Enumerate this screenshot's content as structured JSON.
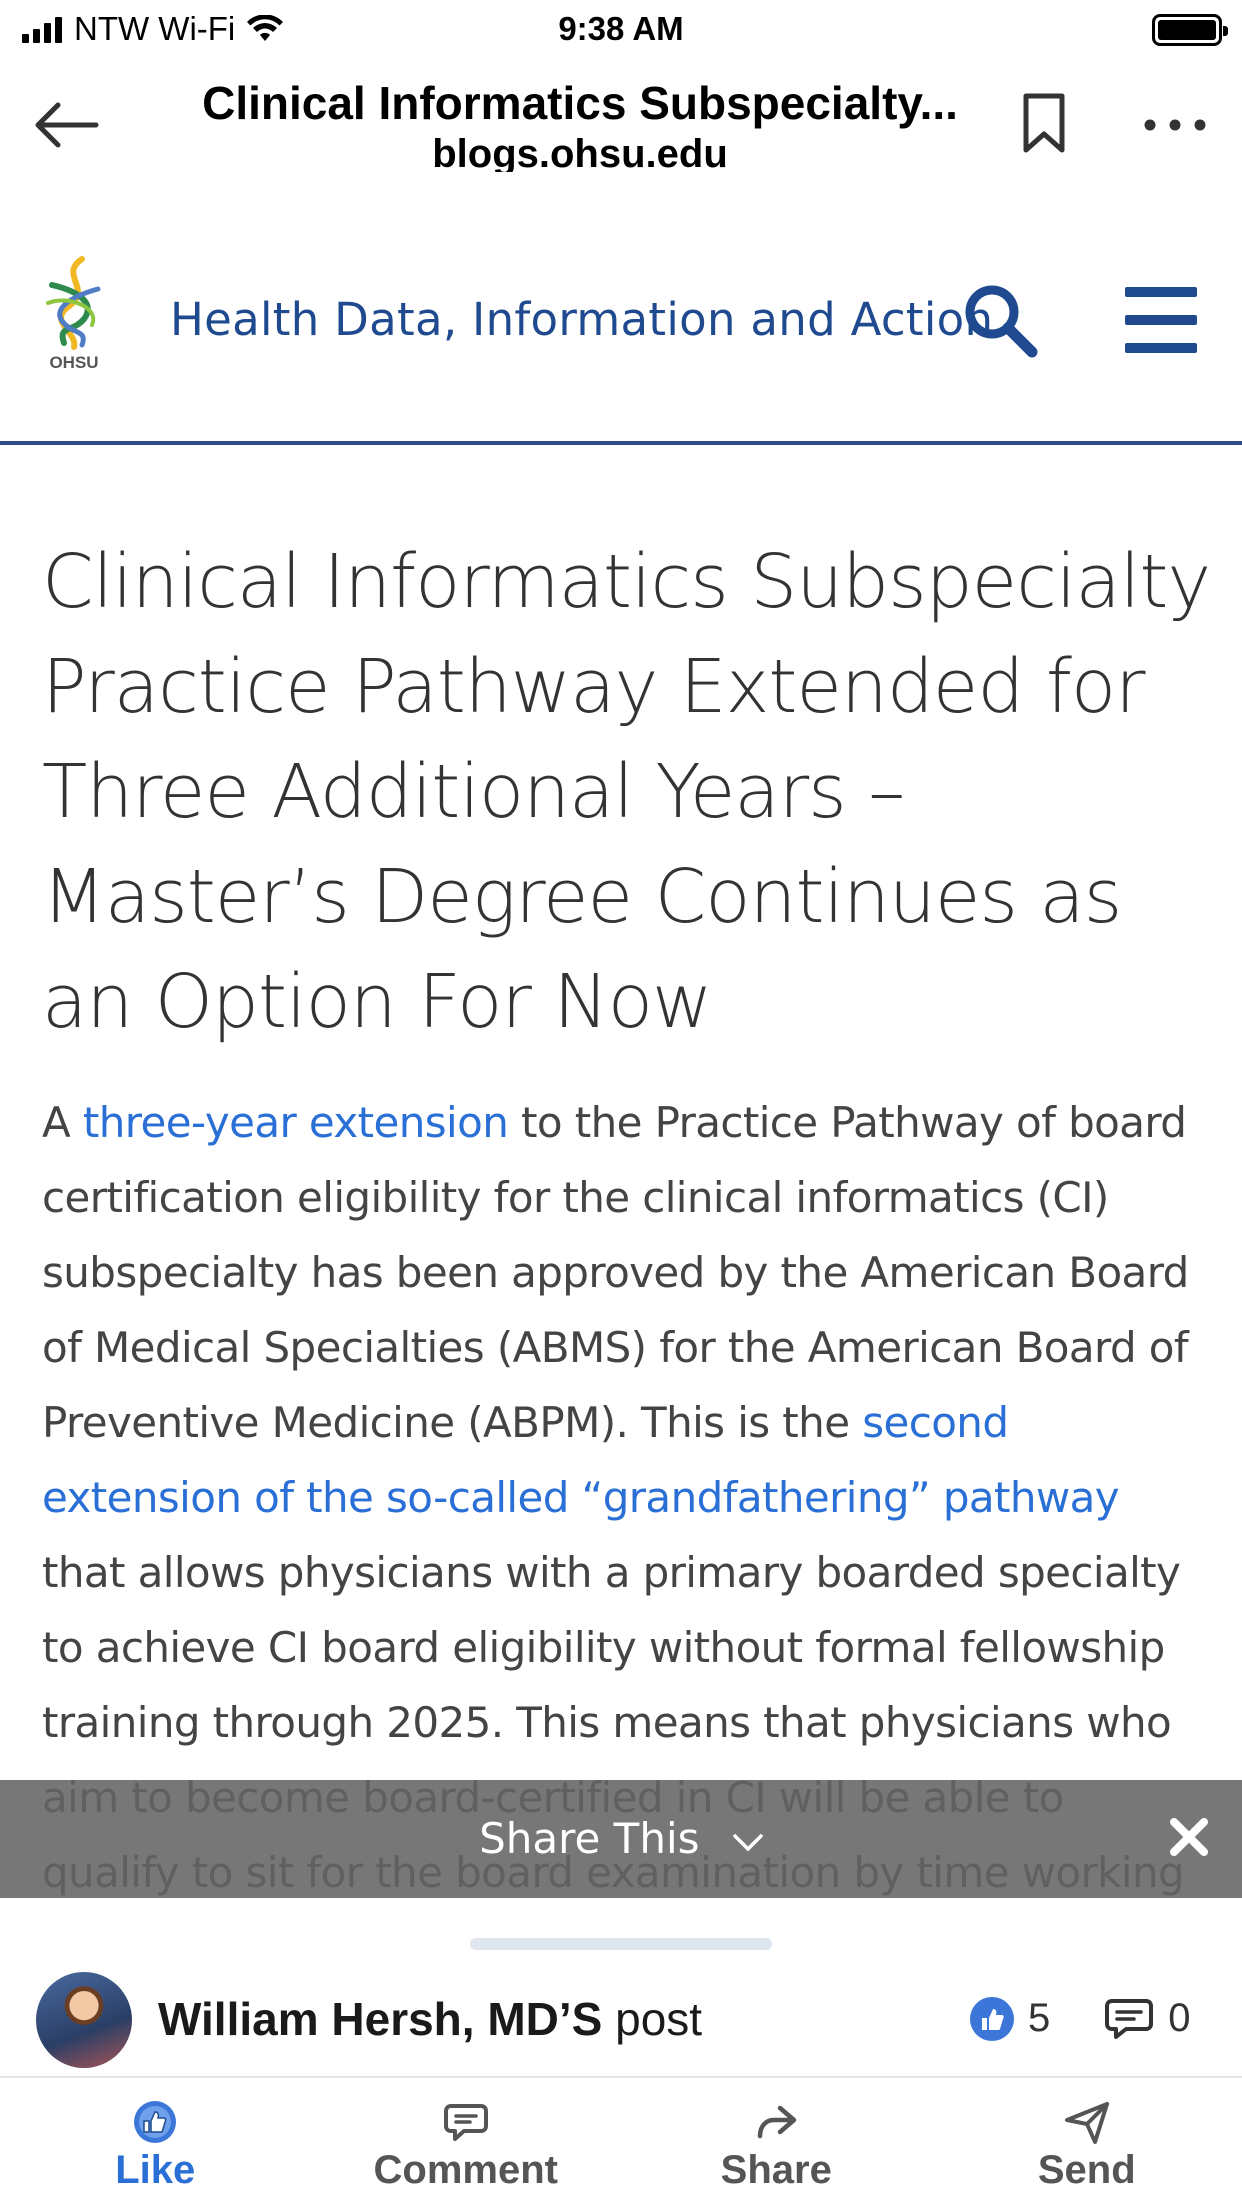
{
  "status_bar": {
    "carrier": "NTW Wi-Fi",
    "time": "9:38 AM"
  },
  "browser": {
    "title": "Clinical Informatics Subspecialty...",
    "url": "blogs.ohsu.edu"
  },
  "site": {
    "logo_text": "OHSU",
    "title": "Health Data, Information and Action"
  },
  "article": {
    "title": "Clinical Informatics Subspecialty Practice Pathway Extended for Three Additional Years – Master’s Degree Continues as an Option For Now",
    "body": {
      "p1_start": "A ",
      "link1": "three-year extension",
      "p1_mid": " to the Practice Pathway of board certification eligibility for the clinical informatics (CI) subspecialty has been approved by the American Board of Medical Specialties (ABMS) for the American Board of Preventive Medicine (ABPM). This is the ",
      "link2": "second extension of the so-called “grandfathering” pathway",
      "p1_end": " that allows physicians with a primary boarded specialty to achieve CI board eligibility without formal fellowship training through 2025. This means that physicians who aim to become board-certified in CI will be able to qualify to sit for the board examination by time working in the field or"
    }
  },
  "share_bar": {
    "label": "Share This"
  },
  "post": {
    "author": "William Hersh, MD’S",
    "suffix": " post",
    "like_count": "5",
    "comment_count": "0"
  },
  "actions": {
    "like": "Like",
    "comment": "Comment",
    "share": "Share",
    "send": "Send"
  },
  "colors": {
    "brand_blue": "#1f4a8f",
    "link_blue": "#2a6fd6",
    "like_blue": "#3b76d8"
  }
}
